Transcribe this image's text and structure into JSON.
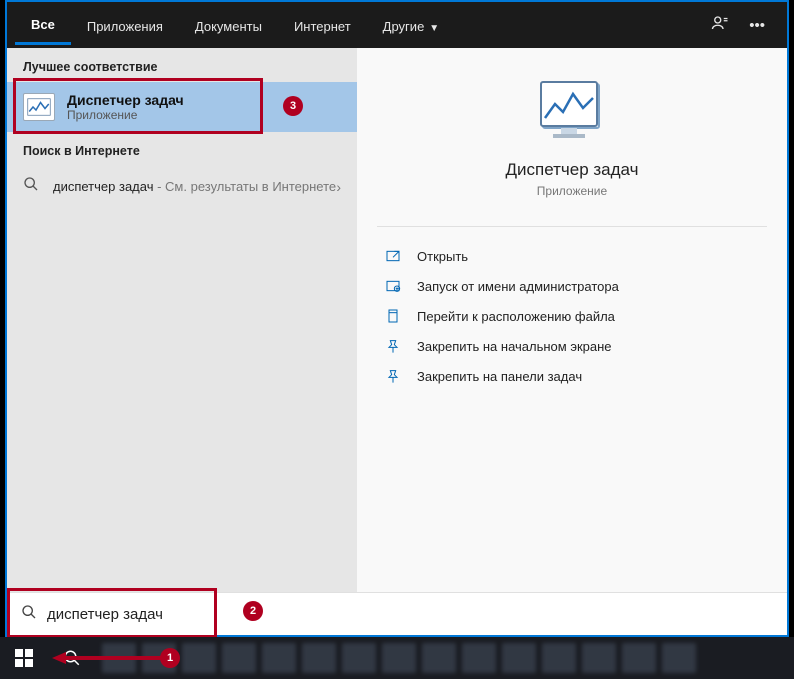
{
  "tabs": {
    "all": "Все",
    "apps": "Приложения",
    "docs": "Документы",
    "web": "Интернет",
    "other": "Другие"
  },
  "sections": {
    "best_match": "Лучшее соответствие",
    "web_search": "Поиск в Интернете"
  },
  "best_match": {
    "title": "Диспетчер задач",
    "subtitle": "Приложение"
  },
  "web_result": {
    "query": "диспетчер задач",
    "suffix": " - См. результаты в Интернете"
  },
  "preview": {
    "title": "Диспетчер задач",
    "subtitle": "Приложение"
  },
  "actions": {
    "open": "Открыть",
    "run_admin": "Запуск от имени администратора",
    "open_location": "Перейти к расположению файла",
    "pin_start": "Закрепить на начальном экране",
    "pin_taskbar": "Закрепить на панели задач"
  },
  "search": {
    "value": "диспетчер задач"
  },
  "annotations": {
    "b1": "1",
    "b2": "2",
    "b3": "3"
  }
}
